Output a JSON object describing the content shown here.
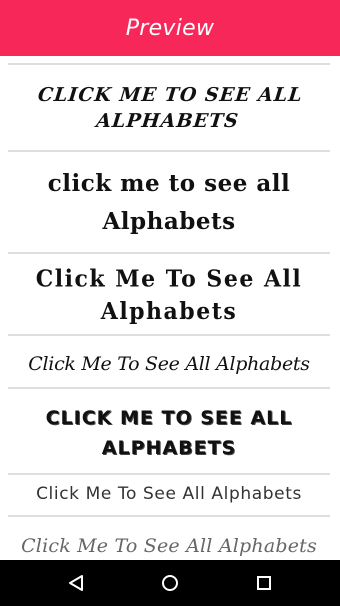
{
  "appbar": {
    "title": "Preview",
    "color": "#f7275a"
  },
  "items": [
    {
      "text": "Click Me To See All Alphabets"
    },
    {
      "text": "click me to see all Alphabets"
    },
    {
      "text": "Click Me To See All Alphabets"
    },
    {
      "text": "Click Me To See All Alphabets"
    },
    {
      "text": "CLICK ME TO SEE ALL ALPHABETS"
    },
    {
      "text": "Click Me To See All Alphabets"
    },
    {
      "text": "Click Me To See All Alphabets"
    }
  ],
  "navbar": {
    "back_icon": "back-triangle-icon",
    "home_icon": "home-circle-icon",
    "recents_icon": "recents-square-icon"
  }
}
